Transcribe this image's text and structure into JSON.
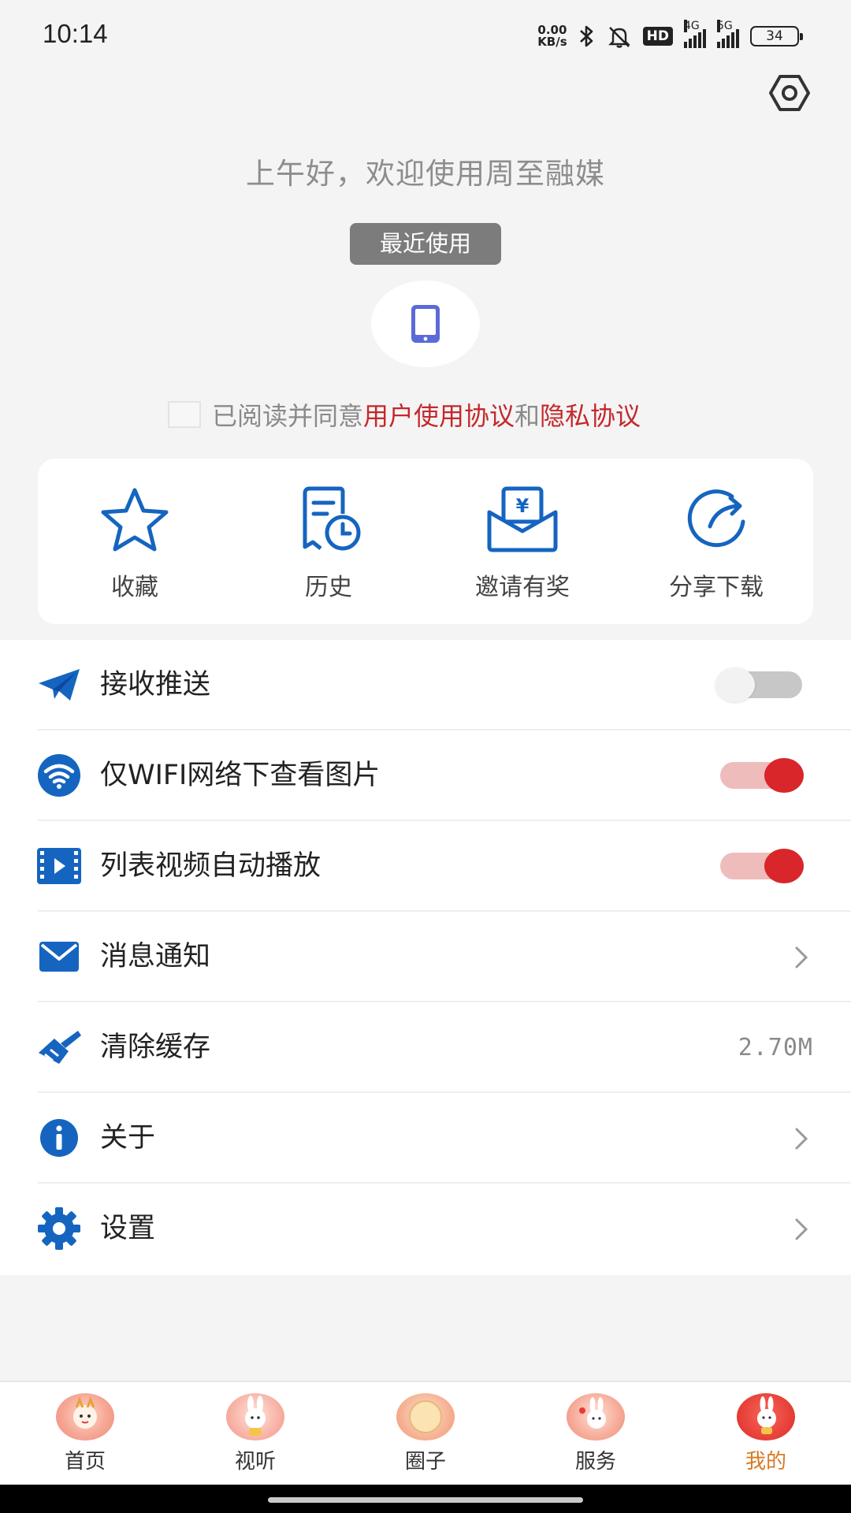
{
  "status_bar": {
    "time": "10:14",
    "net_speed_value": "0.00",
    "net_speed_unit": "KB/s",
    "hd_badge": "HD",
    "signal1_label": "4G",
    "signal2_label": "5G",
    "battery": "34",
    "icons": [
      "bluetooth-icon",
      "mute-bell-icon",
      "hd-icon",
      "signal-4g-icon",
      "signal-5g-icon",
      "battery-icon"
    ]
  },
  "header": {
    "greeting": "上午好，欢迎使用周至融媒",
    "recent_label": "最近使用",
    "recent_icon": "phone-icon"
  },
  "agreement": {
    "prefix": "已阅读并同意",
    "user_agreement": "用户使用协议",
    "and": "和",
    "privacy": "隐私协议"
  },
  "quick_actions": [
    {
      "label": "收藏",
      "icon": "star-icon"
    },
    {
      "label": "历史",
      "icon": "history-icon"
    },
    {
      "label": "邀请有奖",
      "icon": "red-envelope-icon"
    },
    {
      "label": "分享下载",
      "icon": "share-icon"
    }
  ],
  "settings": {
    "push": {
      "label": "接收推送",
      "enabled": false
    },
    "wifi_images": {
      "label": "仅WIFI网络下查看图片",
      "enabled": true
    },
    "autoplay": {
      "label": "列表视频自动播放",
      "enabled": true
    },
    "notifications": {
      "label": "消息通知"
    },
    "clear_cache": {
      "label": "清除缓存",
      "value": "2.70M"
    },
    "about": {
      "label": "关于"
    },
    "settings": {
      "label": "设置"
    }
  },
  "tabbar": [
    {
      "label": "首页",
      "active": false
    },
    {
      "label": "视听",
      "active": false
    },
    {
      "label": "圈子",
      "active": false
    },
    {
      "label": "服务",
      "active": false
    },
    {
      "label": "我的",
      "active": true
    }
  ],
  "colors": {
    "accent_blue": "#1565c0",
    "toggle_on": "#d8262a",
    "link_red": "#c4282c",
    "active_tab": "#d87a24"
  }
}
